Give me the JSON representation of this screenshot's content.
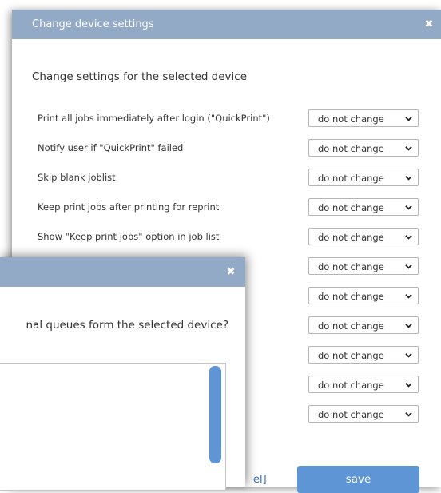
{
  "main_dialog": {
    "title": "Change device settings",
    "close_glyph": "✖",
    "heading": "Change settings for the selected device",
    "rows": [
      {
        "label": "Print all jobs immediately after login (\"QuickPrint\")",
        "value": "do not change"
      },
      {
        "label": "Notify user if \"QuickPrint\" failed",
        "value": "do not change"
      },
      {
        "label": "Skip blank joblist",
        "value": "do not change"
      },
      {
        "label": "Keep print jobs after printing for reprint",
        "value": "do not change"
      },
      {
        "label": "Show \"Keep print jobs\" option in job list",
        "value": "do not change"
      },
      {
        "label": "",
        "value": "do not change"
      },
      {
        "label": "",
        "value": "do not change"
      },
      {
        "label": "",
        "value": "do not change"
      },
      {
        "label": "",
        "value": "do not change"
      },
      {
        "label": "",
        "value": "do not change"
      },
      {
        "label": "",
        "value": "do not change"
      }
    ],
    "cancel_label": "el]",
    "save_label": "save"
  },
  "front_dialog": {
    "close_glyph": "✖",
    "question": "nal queues form the selected device?"
  },
  "colors": {
    "titlebar": "#92aac6",
    "accent": "#5e95d4"
  },
  "icons": {
    "close": "close-icon",
    "select_arrow": "chevron-down-icon"
  }
}
